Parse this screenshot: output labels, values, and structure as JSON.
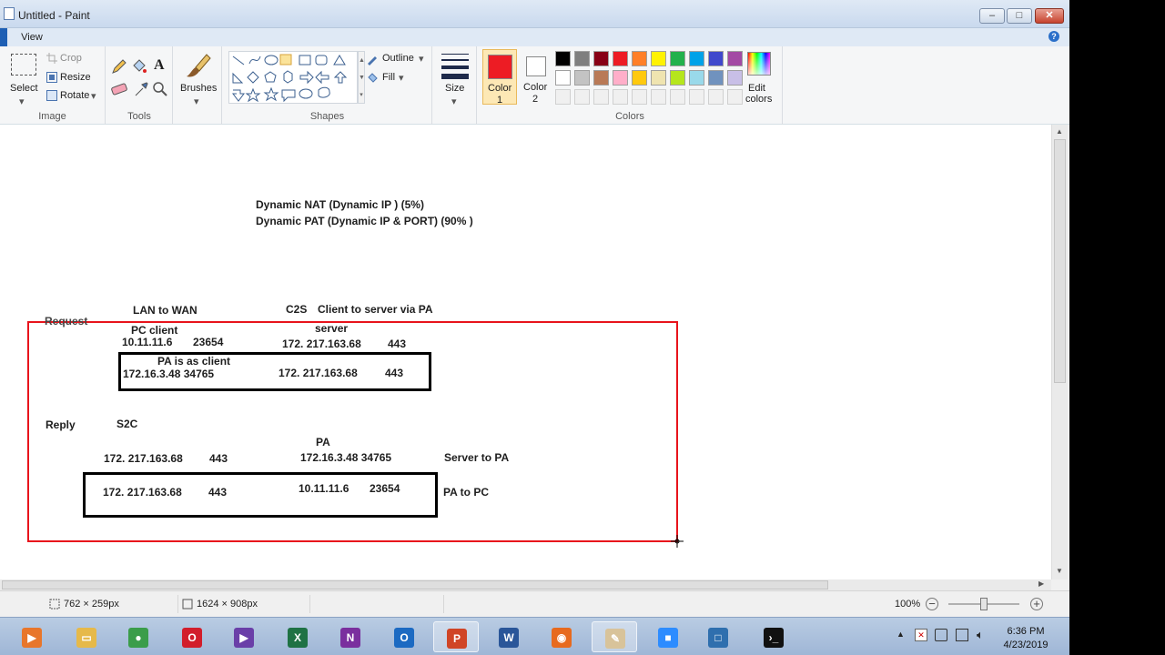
{
  "window": {
    "title": "Untitled - Paint"
  },
  "tabs": {
    "view": "View"
  },
  "ribbon": {
    "image": {
      "group_label": "Image",
      "select": "Select",
      "crop": "Crop",
      "resize": "Resize",
      "rotate": "Rotate"
    },
    "tools": {
      "group_label": "Tools",
      "text_tool": "A"
    },
    "brushes": {
      "label": "Brushes"
    },
    "shapes": {
      "group_label": "Shapes",
      "outline": "Outline",
      "fill": "Fill"
    },
    "size": {
      "label": "Size"
    },
    "colors": {
      "group_label": "Colors",
      "color1_line1": "Color",
      "color1_line2": "1",
      "color2_line1": "Color",
      "color2_line2": "2",
      "color1_value": "#ed1c24",
      "color2_value": "#ffffff",
      "edit_line1": "Edit",
      "edit_line2": "colors",
      "palette_row1": [
        "#000000",
        "#7f7f7f",
        "#880015",
        "#ed1c24",
        "#ff7f27",
        "#fff200",
        "#22b14c",
        "#00a2e8",
        "#3f48cc",
        "#a349a4"
      ],
      "palette_row2": [
        "#ffffff",
        "#c3c3c3",
        "#b97a57",
        "#ffaec9",
        "#ffc90e",
        "#efe4b0",
        "#b5e61d",
        "#99d9ea",
        "#7092be",
        "#c8bfe7"
      ]
    }
  },
  "canvas": {
    "line_nat": "Dynamic NAT  (Dynamic IP ) (5%)",
    "line_pat": "Dynamic PAT (Dynamic IP & PORT)   (90% )",
    "request": "Request",
    "lan_to_wan": "LAN to WAN",
    "c2s": "C2S",
    "client_to_server": "Client to server  via  PA",
    "pc_client": "PC client",
    "server": "server",
    "pc_ip": "10.11.11.6",
    "pc_port": "23654",
    "server_ip": "172. 217.163.68",
    "server_port": "443",
    "pa_as_client": "PA is as client",
    "pa_ip_port": "172.16.3.48  34765",
    "box1_server_ip": "172. 217.163.68",
    "box1_server_port": "443",
    "reply": "Reply",
    "s2c": "S2C",
    "pa": "PA",
    "reply_server_ip": "172. 217.163.68",
    "reply_server_port": "443",
    "reply_pa": "172.16.3.48  34765",
    "server_to_pa": "Server to PA",
    "box2_server_ip": "172. 217.163.68",
    "box2_server_port": "443",
    "box2_pc_ip": "10.11.11.6",
    "box2_pc_port": "23654",
    "pa_to_pc": "PA to PC",
    "red_box_color": "#e8141c"
  },
  "statusbar": {
    "selection_size": "762 × 259px",
    "canvas_size": "1624 × 908px",
    "zoom": "100%"
  },
  "taskbar": {
    "apps": [
      "windows-media-player-icon",
      "file-explorer-icon",
      "chrome-icon",
      "opera-icon",
      "visual-studio-icon",
      "excel-icon",
      "onenote-icon",
      "outlook-icon",
      "powerpoint-icon",
      "word-icon",
      "firefox-icon",
      "paint-icon",
      "zoom-icon",
      "virtualbox-icon",
      "cmd-icon"
    ],
    "time": "6:36 PM",
    "date": "4/23/2019"
  }
}
